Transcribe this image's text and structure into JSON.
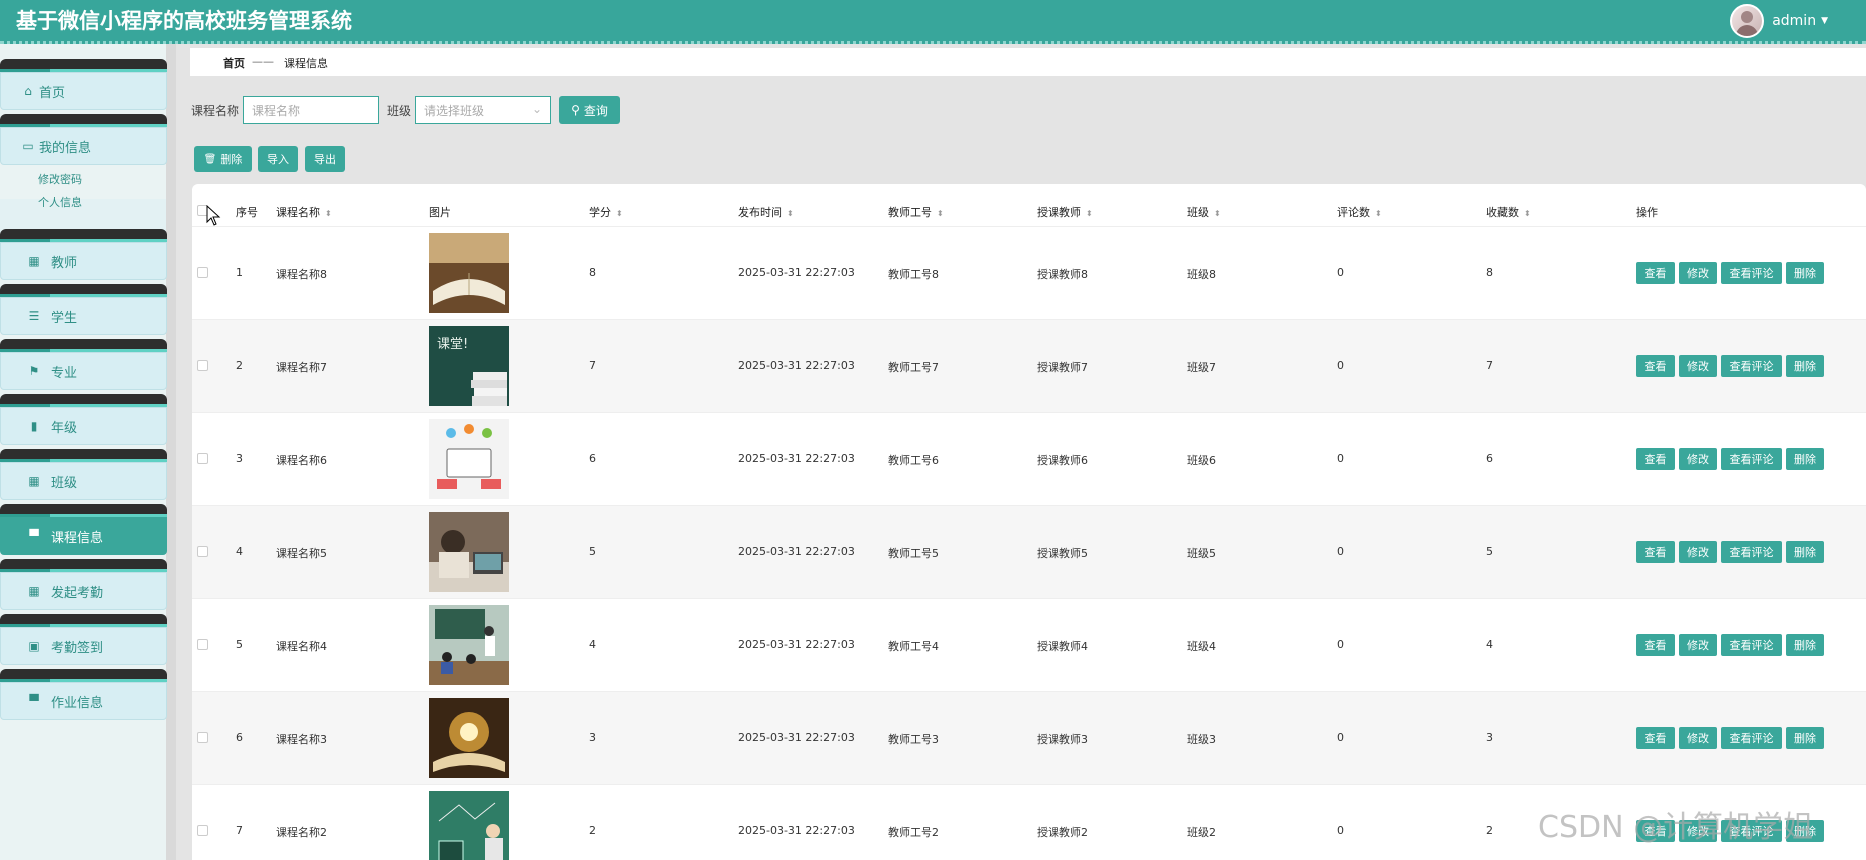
{
  "app": {
    "title": "基于微信小程序的高校班务管理系统",
    "user": "admin"
  },
  "sidebar": {
    "home": "首页",
    "my_info": "我的信息",
    "sub_items": [
      "修改密码",
      "个人信息"
    ],
    "items": [
      "教师",
      "学生",
      "专业",
      "年级",
      "班级",
      "课程信息",
      "发起考勤",
      "考勤签到",
      "作业信息"
    ],
    "active": "课程信息"
  },
  "breadcrumb": {
    "home": "首页",
    "separator": "——",
    "current": "课程信息"
  },
  "search": {
    "course_label": "课程名称",
    "course_placeholder": "课程名称",
    "class_label": "班级",
    "class_placeholder": "请选择班级",
    "search_button": "查询"
  },
  "toolbar": {
    "delete": "删除",
    "import": "导入",
    "export": "导出"
  },
  "table": {
    "headers": [
      "序号",
      "课程名称",
      "图片",
      "学分",
      "发布时间",
      "教师工号",
      "授课教师",
      "班级",
      "评论数",
      "收藏数",
      "操作"
    ],
    "row_actions": [
      "查看",
      "修改",
      "查看评论",
      "删除"
    ],
    "rows": [
      {
        "index": "1",
        "name": "课程名称8",
        "credit": "8",
        "time": "2025-03-31 22:27:03",
        "teacher_no": "教师工号8",
        "teacher": "授课教师8",
        "class": "班级8",
        "comments": "0",
        "favorites": "8",
        "image": "open-book-photo"
      },
      {
        "index": "2",
        "name": "课程名称7",
        "credit": "7",
        "time": "2025-03-31 22:27:03",
        "teacher_no": "教师工号7",
        "teacher": "授课教师7",
        "class": "班级7",
        "comments": "0",
        "favorites": "7",
        "image": "chalkboard-books-photo"
      },
      {
        "index": "3",
        "name": "课程名称6",
        "credit": "6",
        "time": "2025-03-31 22:27:03",
        "teacher_no": "教师工号6",
        "teacher": "授课教师6",
        "class": "班级6",
        "comments": "0",
        "favorites": "6",
        "image": "e-learning-illustration"
      },
      {
        "index": "4",
        "name": "课程名称5",
        "credit": "5",
        "time": "2025-03-31 22:27:03",
        "teacher_no": "教师工号5",
        "teacher": "授课教师5",
        "class": "班级5",
        "comments": "0",
        "favorites": "5",
        "image": "laptop-study-photo"
      },
      {
        "index": "5",
        "name": "课程名称4",
        "credit": "4",
        "time": "2025-03-31 22:27:03",
        "teacher_no": "教师工号4",
        "teacher": "授课教师4",
        "class": "班级4",
        "comments": "0",
        "favorites": "4",
        "image": "classroom-photo"
      },
      {
        "index": "6",
        "name": "课程名称3",
        "credit": "3",
        "time": "2025-03-31 22:27:03",
        "teacher_no": "教师工号3",
        "teacher": "授课教师3",
        "class": "班级3",
        "comments": "0",
        "favorites": "3",
        "image": "glowing-book-photo"
      },
      {
        "index": "7",
        "name": "课程名称2",
        "credit": "2",
        "time": "2025-03-31 22:27:03",
        "teacher_no": "教师工号2",
        "teacher": "授课教师2",
        "class": "班级2",
        "comments": "0",
        "favorites": "2",
        "image": "teacher-chalkboard-photo"
      }
    ]
  },
  "watermark": "CSDN @计算机学姐",
  "colors": {
    "primary": "#3aa79b",
    "header": "#38a69b",
    "menu_bar": "#2e2e2e",
    "menu_body": "#d7eef3"
  }
}
